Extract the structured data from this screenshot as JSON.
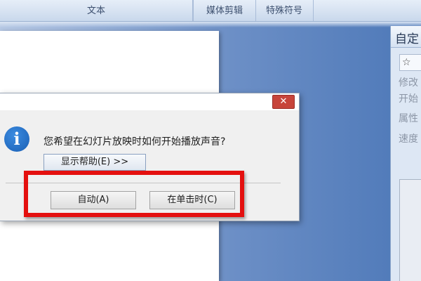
{
  "ribbon": {
    "groups": [
      {
        "label": "文本"
      },
      {
        "label": "媒体剪辑"
      },
      {
        "label": "特殊符号"
      }
    ]
  },
  "task_pane": {
    "title": "自定",
    "labels": [
      "修改",
      "开始",
      "属性",
      "速度"
    ],
    "icon": "star-add-icon"
  },
  "dialog": {
    "message": "您希望在幻灯片放映时如何开始播放声音?",
    "help_button": "显示帮助(E) >>",
    "auto_button": "自动(A)",
    "on_click_button": "在单击时(C)",
    "close_glyph": "✕",
    "info_glyph": "i"
  },
  "colors": {
    "highlight": "#e4100f",
    "close_button": "#c7443a",
    "info_icon": "#1a5fb4"
  }
}
